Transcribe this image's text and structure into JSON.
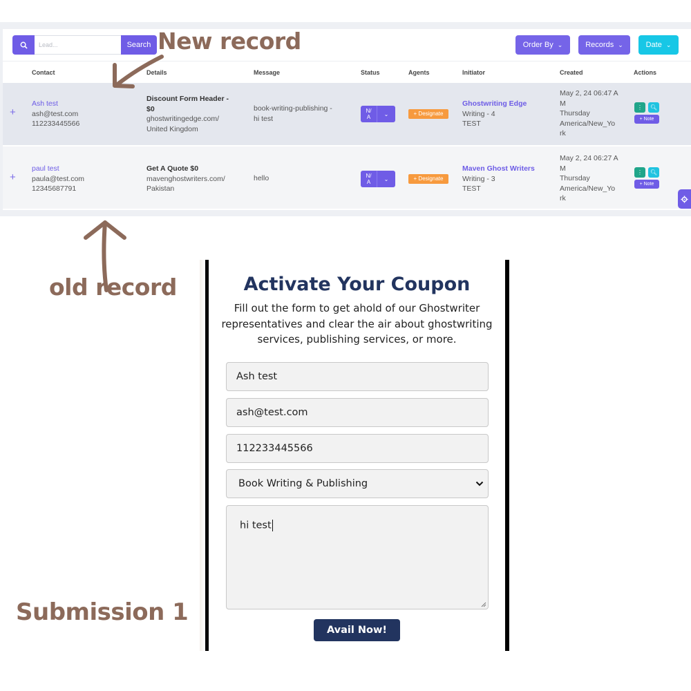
{
  "crm": {
    "search": {
      "placeholder": "Lead...",
      "button_label": "Search"
    },
    "toolbar": {
      "order_by_label": "Order By",
      "records_label": "Records",
      "date_label": "Date"
    },
    "columns": [
      "Contact",
      "Details",
      "Message",
      "Status",
      "Agents",
      "Initiator",
      "Created",
      "Actions"
    ],
    "rows": [
      {
        "contact_name": "Ash test",
        "contact_email": "ash@test.com",
        "contact_phone": "112233445566",
        "details_title_line1": "Discount Form Header -",
        "details_title_line2": "$0",
        "details_site": "ghostwritingedge.com/",
        "details_country": "United Kingdom",
        "message_line1": "book-writing-publishing -",
        "message_line2": "hi test",
        "status_line1": "N/",
        "status_line2": "A",
        "agent_button": "+ Designate",
        "initiator_brand": "Ghostwriting Edge",
        "initiator_team": "Writing - 4",
        "initiator_tag": "TEST",
        "created_line1": "May 2, 24 06:47 A",
        "created_line2": "M",
        "created_line3": "Thursday",
        "created_line4": "America/New_Yo",
        "created_line5": "rk",
        "note_label": "+ Note"
      },
      {
        "contact_name": "paul test",
        "contact_email": "paula@test.com",
        "contact_phone": "12345687791",
        "details_title_line1": "Get A Quote $0",
        "details_title_line2": "",
        "details_site": "mavenghostwriters.com/",
        "details_country": "Pakistan",
        "message_line1": "hello",
        "message_line2": "",
        "status_line1": "N/",
        "status_line2": "A",
        "agent_button": "+ Designate",
        "initiator_brand": "Maven Ghost Writers",
        "initiator_team": "Writing - 3",
        "initiator_tag": "TEST",
        "created_line1": "May 2, 24 06:27 A",
        "created_line2": "M",
        "created_line3": "Thursday",
        "created_line4": "America/New_Yo",
        "created_line5": "rk",
        "note_label": "+ Note"
      }
    ]
  },
  "annotations": {
    "new_record": "New record",
    "old_record": "old record",
    "submission": "Submission 1"
  },
  "form": {
    "title": "Activate Your Coupon",
    "subtitle": "Fill out the form to get ahold of our Ghostwriter representatives and clear the air about ghostwriting services, publishing services, or more.",
    "name_value": "Ash test",
    "email_value": "ash@test.com",
    "phone_value": "112233445566",
    "service_selected": "Book Writing & Publishing",
    "message_value": "hi test",
    "submit_label": "Avail Now!"
  },
  "colors": {
    "accent": "#6f5ce6",
    "cyan": "#17c7e6",
    "designate_orange": "#f79a3e",
    "annotation_brown": "#8c6a5a",
    "form_navy": "#22345f"
  },
  "icons": [
    "search-icon",
    "chevron-down-icon",
    "plus-icon",
    "more-icon",
    "magnifier-icon",
    "gear-icon",
    "arrow-icon"
  ]
}
